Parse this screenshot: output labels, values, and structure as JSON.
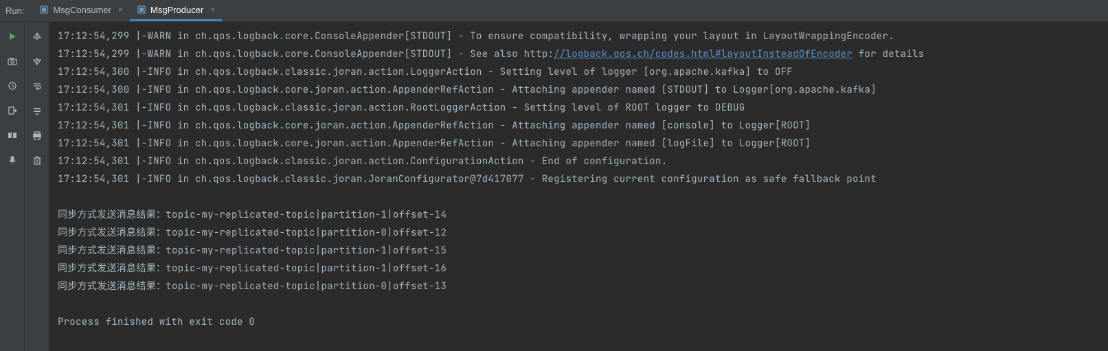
{
  "header": {
    "run_label": "Run:",
    "tabs": [
      {
        "label": "MsgConsumer",
        "active": false
      },
      {
        "label": "MsgProducer",
        "active": true
      }
    ]
  },
  "log_lines": [
    {
      "type": "log",
      "text": "17:12:54,299 |-WARN in ch.qos.logback.core.ConsoleAppender[STDOUT] - To ensure compatibility, wrapping your layout in LayoutWrappingEncoder."
    },
    {
      "type": "log",
      "prefix": "17:12:54,299 |-WARN in ch.qos.logback.core.ConsoleAppender[STDOUT] - See also http:",
      "link": "//logback.qos.ch/codes.html#layoutInsteadOfEncoder",
      "suffix": " for details"
    },
    {
      "type": "log",
      "text": "17:12:54,300 |-INFO in ch.qos.logback.classic.joran.action.LoggerAction - Setting level of logger [org.apache.kafka] to OFF"
    },
    {
      "type": "log",
      "text": "17:12:54,300 |-INFO in ch.qos.logback.core.joran.action.AppenderRefAction - Attaching appender named [STDOUT] to Logger[org.apache.kafka]"
    },
    {
      "type": "log",
      "text": "17:12:54,301 |-INFO in ch.qos.logback.classic.joran.action.RootLoggerAction - Setting level of ROOT logger to DEBUG"
    },
    {
      "type": "log",
      "text": "17:12:54,301 |-INFO in ch.qos.logback.core.joran.action.AppenderRefAction - Attaching appender named [console] to Logger[ROOT]"
    },
    {
      "type": "log",
      "text": "17:12:54,301 |-INFO in ch.qos.logback.core.joran.action.AppenderRefAction - Attaching appender named [logFile] to Logger[ROOT]"
    },
    {
      "type": "log",
      "text": "17:12:54,301 |-INFO in ch.qos.logback.classic.joran.action.ConfigurationAction - End of configuration."
    },
    {
      "type": "log",
      "text": "17:12:54,301 |-INFO in ch.qos.logback.classic.joran.JoranConfigurator@7d417077 - Registering current configuration as safe fallback point"
    },
    {
      "type": "blank"
    },
    {
      "type": "output",
      "text": "同步方式发送消息结果：topic-my-replicated-topic|partition-1|offset-14"
    },
    {
      "type": "output",
      "text": "同步方式发送消息结果：topic-my-replicated-topic|partition-0|offset-12"
    },
    {
      "type": "output",
      "text": "同步方式发送消息结果：topic-my-replicated-topic|partition-1|offset-15"
    },
    {
      "type": "output",
      "text": "同步方式发送消息结果：topic-my-replicated-topic|partition-1|offset-16"
    },
    {
      "type": "output",
      "text": "同步方式发送消息结果：topic-my-replicated-topic|partition-0|offset-13"
    },
    {
      "type": "blank"
    },
    {
      "type": "output",
      "text": "Process finished with exit code 0"
    }
  ],
  "icons": {
    "run": "run-icon",
    "camera": "camera-icon",
    "debug": "debug-icon",
    "exit": "exit-icon",
    "layout": "layout-icon",
    "pin": "pin-icon",
    "up": "up-arrow-icon",
    "down": "down-arrow-icon",
    "wrap": "wrap-icon",
    "scroll": "scroll-icon",
    "print": "print-icon",
    "trash": "trash-icon"
  }
}
